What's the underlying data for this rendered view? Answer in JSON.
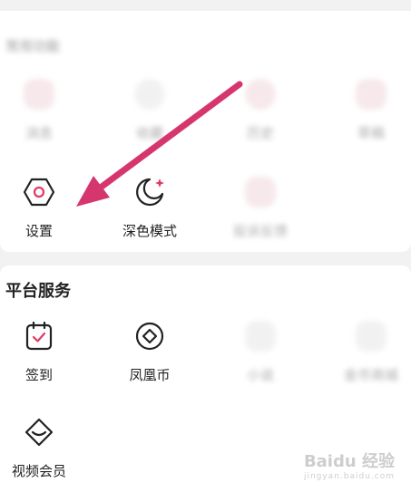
{
  "top_section": {
    "title": "常用功能",
    "row1": [
      {
        "label": "消息",
        "icon": "message-icon"
      },
      {
        "label": "收藏",
        "icon": "star-icon"
      },
      {
        "label": "历史",
        "icon": "history-icon"
      },
      {
        "label": "草稿",
        "icon": "drafts-icon"
      }
    ],
    "row2": [
      {
        "label": "设置",
        "icon": "settings-hexagon-icon"
      },
      {
        "label": "深色模式",
        "icon": "moon-icon"
      },
      {
        "label": "投诉反馈",
        "icon": "feedback-icon"
      }
    ]
  },
  "platform": {
    "title": "平台服务",
    "items": [
      {
        "label": "签到",
        "icon": "calendar-check-icon"
      },
      {
        "label": "凤凰币",
        "icon": "coin-diamond-icon"
      },
      {
        "label": "小说",
        "icon": "book-icon"
      },
      {
        "label": "金币商城",
        "icon": "store-icon"
      },
      {
        "label": "视频会员",
        "icon": "vip-diamond-icon"
      }
    ]
  },
  "watermark": {
    "text": "Baidu 经验",
    "sub": "jingyan.baidu.com"
  },
  "colors": {
    "accent_arrow": "#d6366e",
    "icon_pink": "#e03a60",
    "background": "#f2f2f3"
  }
}
